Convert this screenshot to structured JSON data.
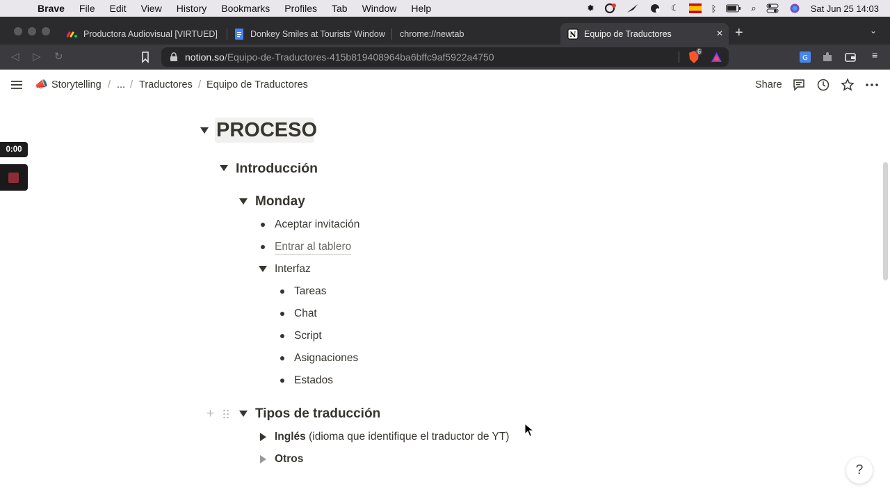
{
  "menubar": {
    "app": "Brave",
    "items": [
      "File",
      "Edit",
      "View",
      "History",
      "Bookmarks",
      "Profiles",
      "Tab",
      "Window",
      "Help"
    ],
    "clock": "Sat Jun 25  14:03"
  },
  "tabs": [
    {
      "label": "Productora Audiovisual [VIRTUED]",
      "icon": "monday-logo-icon"
    },
    {
      "label": "Donkey Smiles at Tourists' Window",
      "icon": "google-docs-icon"
    },
    {
      "label": "chrome://newtab",
      "icon": ""
    },
    {
      "label": "Equipo de Traductores",
      "icon": "notion-icon",
      "close": "✕"
    }
  ],
  "url": {
    "host": "notion.so",
    "path": "/Equipo-de-Traductores-415b819408964ba6bffc9af5922a4750"
  },
  "brave_shield_count": "6",
  "breadcrumb": {
    "root": "Storytelling",
    "ellipsis": "...",
    "parent": "Traductores",
    "current": "Equipo de Traductores",
    "separator": "/"
  },
  "header": {
    "share_label": "Share"
  },
  "recording": {
    "timer": "0:00"
  },
  "content": {
    "h1": "PROCESO",
    "section1": "Introducción",
    "monday": "Monday",
    "items": [
      "Aceptar invitación",
      "Entrar al tablero"
    ],
    "interfaz": "Interfaz",
    "interfaz_items": [
      "Tareas",
      "Chat",
      "Script",
      "Asignaciones",
      "Estados"
    ],
    "section2": "Tipos de traducción",
    "ingles_bold": "Inglés",
    "ingles_rest": " (idioma que identifique el traductor de YT)",
    "otros": "Otros"
  },
  "help_label": "?"
}
